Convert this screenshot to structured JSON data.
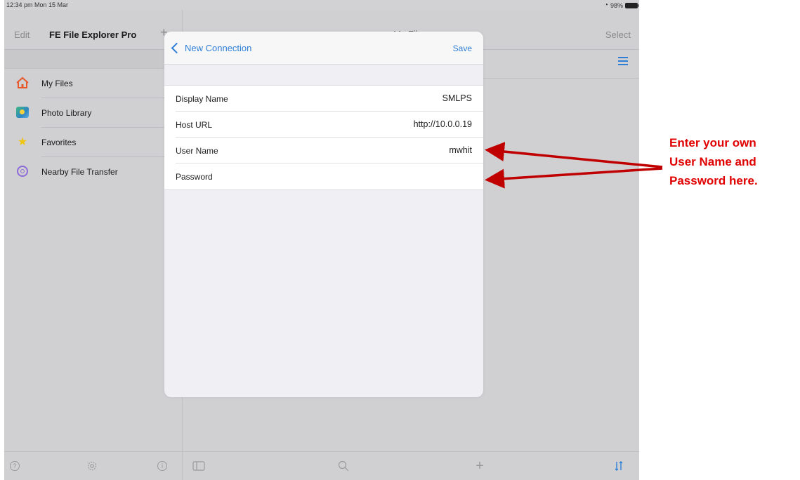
{
  "status_bar": {
    "time": "12:34 pm  Mon 15 Mar",
    "battery": "98%"
  },
  "sidebar": {
    "edit_label": "Edit",
    "title": "FE File Explorer Pro",
    "items": [
      {
        "label": "My Files",
        "icon": "home-icon"
      },
      {
        "label": "Photo Library",
        "icon": "photo-icon"
      },
      {
        "label": "Favorites",
        "icon": "star-icon"
      },
      {
        "label": "Nearby File Transfer",
        "icon": "airdrop-icon"
      }
    ],
    "toolbar_icons": [
      "help-icon",
      "gear-icon",
      "info-icon"
    ]
  },
  "main": {
    "title": "My Files",
    "select_label": "Select",
    "toolbar_icons": [
      "sidebar-toggle-icon",
      "search-icon",
      "plus-icon",
      "sort-icon"
    ]
  },
  "modal": {
    "back_label": "New Connection",
    "save_label": "Save",
    "fields": [
      {
        "label": "Display Name",
        "value": "SMLPS"
      },
      {
        "label": "Host URL",
        "value": "http://10.0.0.19"
      },
      {
        "label": "User Name",
        "value": "mwhit"
      },
      {
        "label": "Password",
        "value": ""
      }
    ]
  },
  "annotation": {
    "line1": "Enter your own",
    "line2": "User Name and",
    "line3": "Password here.",
    "color": "#e00000"
  },
  "colors": {
    "accent": "#2f7fd6",
    "annotation_red": "#c00000"
  }
}
